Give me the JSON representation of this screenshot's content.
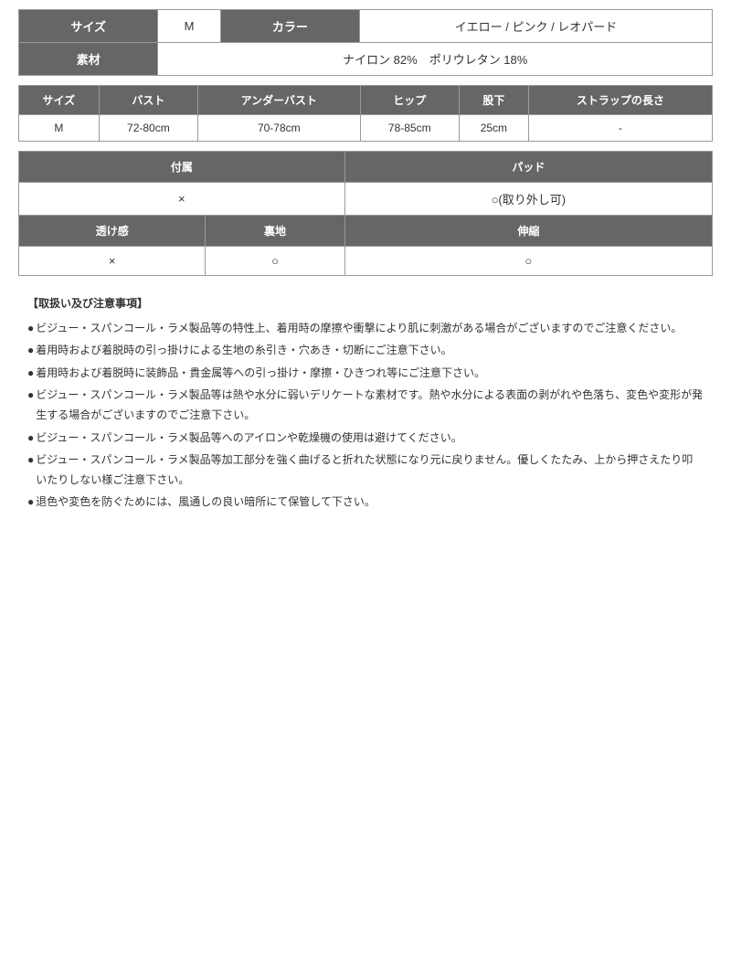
{
  "product": {
    "size_label": "サイズ",
    "size_value": "M",
    "color_label": "カラー",
    "color_value": "イエロー / ピンク / レオパード",
    "material_label": "素材",
    "material_value": "ナイロン 82%　ポリウレタン 18%"
  },
  "size_table": {
    "headers": [
      "サイズ",
      "バスト",
      "アンダーバスト",
      "ヒップ",
      "股下",
      "ストラップの長さ"
    ],
    "rows": [
      [
        "M",
        "72-80cm",
        "70-78cm",
        "78-85cm",
        "25cm",
        "-"
      ]
    ]
  },
  "features": {
    "rows": [
      {
        "cols": [
          {
            "text": "付属",
            "type": "header",
            "rowspan": 1
          },
          {
            "text": "パッド",
            "type": "header",
            "rowspan": 1
          }
        ]
      },
      {
        "cols": [
          {
            "text": "×",
            "type": "value"
          },
          {
            "text": "○(取り外し可)",
            "type": "value"
          }
        ]
      },
      {
        "cols": [
          {
            "text": "透け感",
            "type": "header"
          },
          {
            "text": "裏地",
            "type": "header"
          },
          {
            "text": "伸縮",
            "type": "header"
          }
        ]
      },
      {
        "cols": [
          {
            "text": "×",
            "type": "value"
          },
          {
            "text": "○",
            "type": "value"
          },
          {
            "text": "○",
            "type": "value"
          }
        ]
      }
    ]
  },
  "notes": {
    "title": "【取扱い及び注意事項】",
    "items": [
      "ビジュー・スパンコール・ラメ製品等の特性上、着用時の摩擦や衝撃により肌に刺激がある場合がございますのでご注意ください。",
      "着用時および着脱時の引っ掛けによる生地の糸引き・穴あき・切断にご注意下さい。",
      "着用時および着脱時に装飾品・貴金属等への引っ掛け・摩擦・ひきつれ等にご注意下さい。",
      "ビジュー・スパンコール・ラメ製品等は熱や水分に弱いデリケートな素材です。熱や水分による表面の剥がれや色落ち、変色や変形が発生する場合がございますのでご注意下さい。",
      "ビジュー・スパンコール・ラメ製品等へのアイロンや乾燥機の使用は避けてください。",
      "ビジュー・スパンコール・ラメ製品等加工部分を強く曲げると折れた状態になり元に戻りません。優しくたたみ、上から押さえたり叩いたりしない様ご注意下さい。",
      "退色や変色を防ぐためには、風通しの良い暗所にて保管して下さい。"
    ]
  }
}
